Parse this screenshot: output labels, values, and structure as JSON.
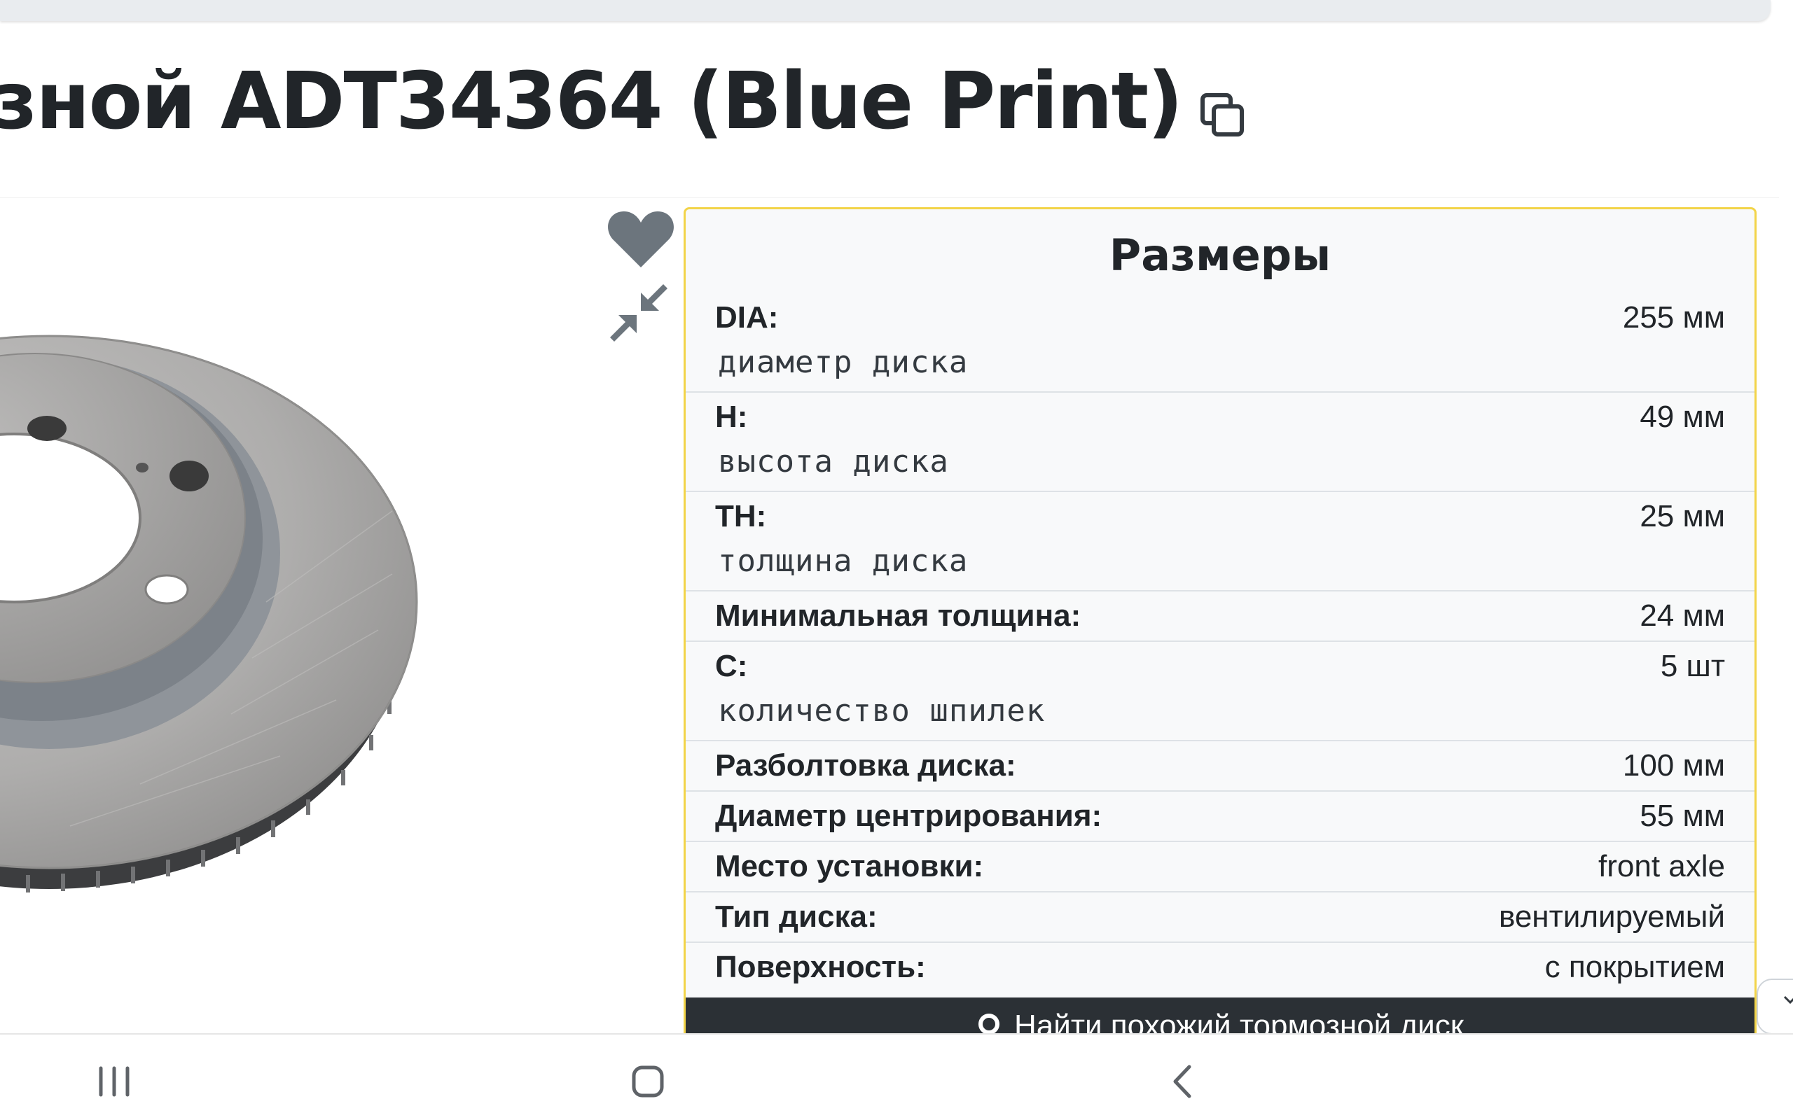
{
  "header": {
    "title": "зной ADT34364 (Blue Print)"
  },
  "dimensions": {
    "title": "Размеры",
    "rows": [
      {
        "label": "DIA:",
        "value": "255 мм",
        "desc": "диаметр диска"
      },
      {
        "label": "H:",
        "value": "49 мм",
        "desc": "высота диска"
      },
      {
        "label": "TH:",
        "value": "25 мм",
        "desc": "толщина диска"
      },
      {
        "label": "Минимальная толщина:",
        "value": "24 мм",
        "desc": ""
      },
      {
        "label": "C:",
        "value": "5 шт",
        "desc": "количество шпилек"
      },
      {
        "label": "Разболтовка диска:",
        "value": "100 мм",
        "desc": ""
      },
      {
        "label": "Диаметр центрирования:",
        "value": "55 мм",
        "desc": ""
      },
      {
        "label": "Место установки:",
        "value": "front axle",
        "desc": ""
      },
      {
        "label": "Тип диска:",
        "value": "вентилируемый",
        "desc": ""
      },
      {
        "label": "Поверхность:",
        "value": "с покрытием",
        "desc": ""
      }
    ],
    "find_similar_label": "Найти похожий тормозной диск"
  },
  "icons": {
    "copy": "copy-icon",
    "favorite": "heart-icon",
    "compress": "compress-icon",
    "search": "search-icon",
    "scroll": "chevron-up-icon",
    "nav_recents": "recents-icon",
    "nav_home": "home-icon",
    "nav_back": "back-icon"
  },
  "colors": {
    "card_border": "#f2d449",
    "card_bg": "#f8f9fa",
    "button_bg": "#2b3035",
    "icon_gray": "#6c757d"
  }
}
